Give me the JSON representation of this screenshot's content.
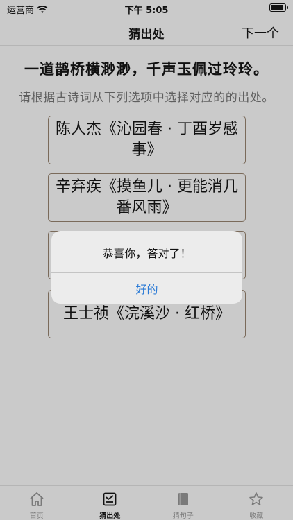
{
  "status_bar": {
    "carrier": "运营商",
    "time": "下午 5:05"
  },
  "nav": {
    "title": "猜出处",
    "next_label": "下一个"
  },
  "question": {
    "poem_line": "一道鹊桥横渺渺，千声玉佩过玲玲。",
    "instruction": "请根据古诗词从下列选项中选择对应的的出处。"
  },
  "options": [
    "陈人杰《沁园春 · 丁酉岁感事》",
    "辛弃疾《摸鱼儿 · 更能消几番风雨》",
    "",
    "王士祯《浣溪沙 · 红桥》"
  ],
  "alert": {
    "message": "恭喜你，答对了！",
    "ok_label": "好的"
  },
  "tabs": [
    {
      "label": "首页",
      "icon": "home-icon",
      "active": false
    },
    {
      "label": "猜出处",
      "icon": "guess-source-icon",
      "active": true
    },
    {
      "label": "猜句子",
      "icon": "book-icon",
      "active": false
    },
    {
      "label": "收藏",
      "icon": "star-icon",
      "active": false
    }
  ]
}
